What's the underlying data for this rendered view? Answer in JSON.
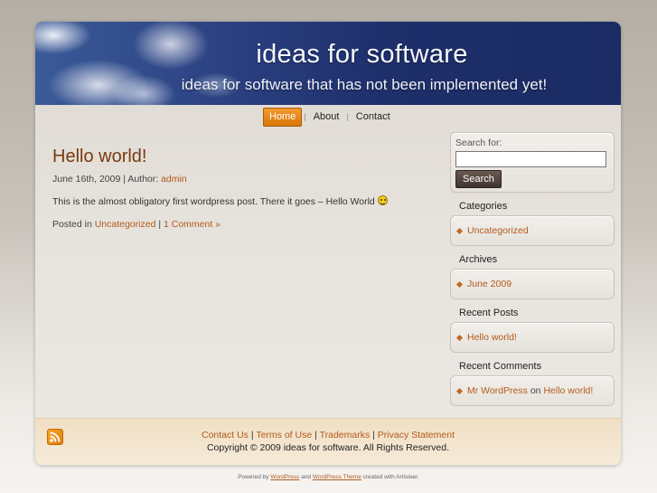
{
  "header": {
    "title": "ideas for software",
    "slogan": "ideas for software that has not been implemented yet!"
  },
  "nav": {
    "items": [
      {
        "label": "Home",
        "active": true
      },
      {
        "label": "About",
        "active": false
      },
      {
        "label": "Contact",
        "active": false
      }
    ]
  },
  "post": {
    "title": "Hello world!",
    "date": "June 16th, 2009",
    "author_prefix": "| Author:",
    "author": "admin",
    "body": "This is the almost obligatory first wordpress post. There it goes – Hello World",
    "posted_in": "Posted in",
    "category": "Uncategorized",
    "separator": "|",
    "comments": "1 Comment »"
  },
  "sidebar": {
    "search": {
      "label": "Search for:",
      "value": "",
      "button": "Search"
    },
    "categories": {
      "title": "Categories",
      "items": [
        "Uncategorized"
      ]
    },
    "archives": {
      "title": "Archives",
      "items": [
        "June 2009"
      ]
    },
    "recent_posts": {
      "title": "Recent Posts",
      "items": [
        "Hello world!"
      ]
    },
    "recent_comments": {
      "title": "Recent Comments",
      "author": "Mr WordPress",
      "on": "on",
      "post": "Hello world!"
    }
  },
  "footer": {
    "links": [
      "Contact Us",
      "Terms of Use",
      "Trademarks",
      "Privacy Statement"
    ],
    "separator": "|",
    "copyright": "Copyright © 2009 ideas for software. All Rights Reserved."
  },
  "powered": {
    "prefix": "Powered by",
    "wordpress": "WordPress",
    "and": "and",
    "theme": "WordPress Theme",
    "suffix": "created with Artisteer."
  },
  "colors": {
    "accent": "#d97706",
    "link": "#b35a1a",
    "header_blue": "#1e2f6b"
  }
}
